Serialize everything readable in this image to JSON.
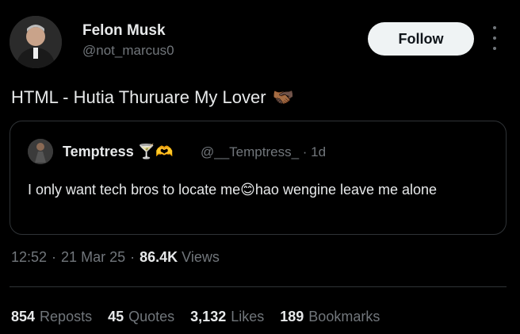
{
  "tweet": {
    "author": {
      "name": "Felon Musk",
      "handle": "@not_marcus0"
    },
    "follow_label": "Follow",
    "text": "HTML - Hutia Thuruare My Lover",
    "emoji": "🫱🏾‍🫲🏿"
  },
  "quote": {
    "author": {
      "name": "Temptress",
      "badges": "🍸🫶",
      "handle": "@__Temptress_",
      "dot": "·",
      "time": "1d"
    },
    "text_before": "I only want tech bros to locate me",
    "emoji": "😊",
    "text_after": "hao wengine leave me alone"
  },
  "meta": {
    "time": "12:52",
    "sep1": "·",
    "date": "21 Mar 25",
    "sep2": "·",
    "views_count": "86.4K",
    "views_label": "Views"
  },
  "stats": [
    {
      "count": "854",
      "label": "Reposts"
    },
    {
      "count": "45",
      "label": "Quotes"
    },
    {
      "count": "3,132",
      "label": "Likes"
    },
    {
      "count": "189",
      "label": "Bookmarks"
    }
  ],
  "colors": {
    "background": "#000000",
    "text": "#e7e9ea",
    "secondary": "#71767b",
    "border": "#2f3336",
    "button_bg": "#eff3f4"
  }
}
